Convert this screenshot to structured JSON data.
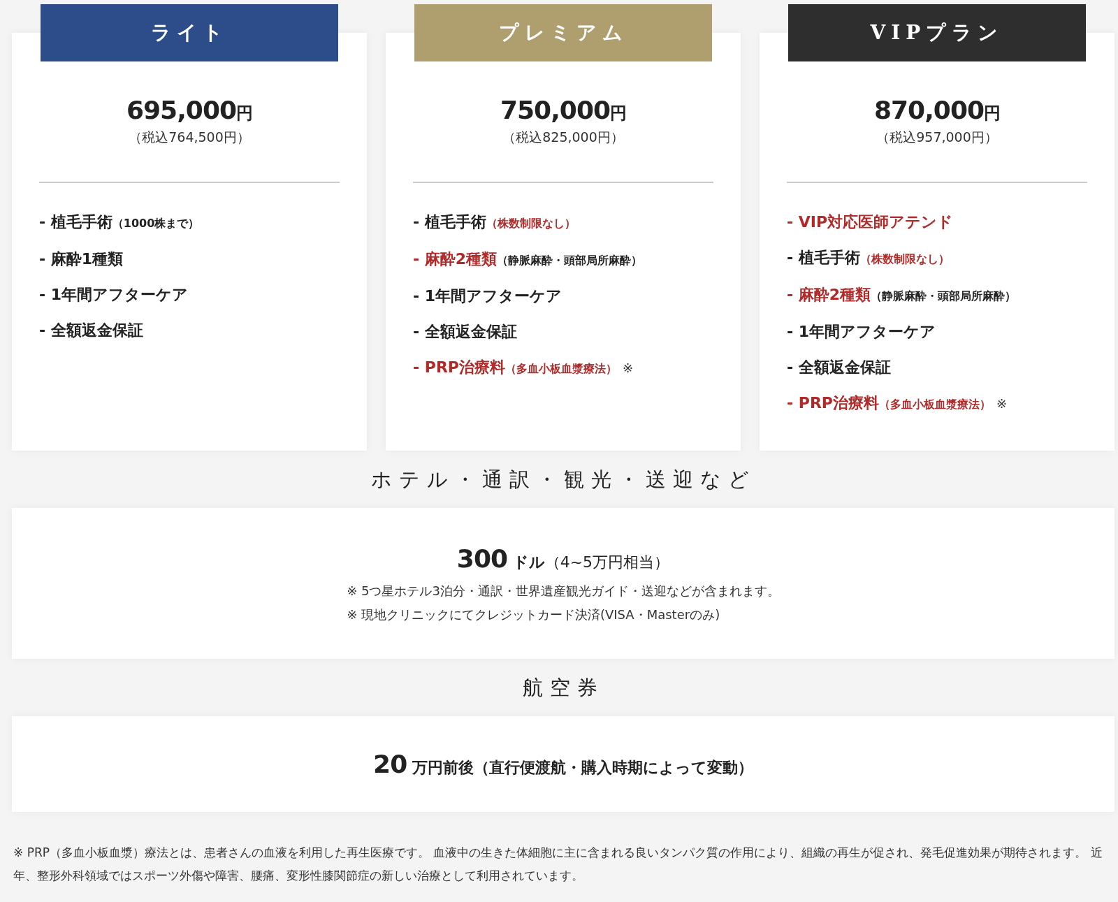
{
  "plans": [
    {
      "name": "ライト",
      "color": "#2c4d8a",
      "price": "695,000",
      "unit": "円",
      "tax": "（税込764,500円）",
      "features": [
        {
          "text": "- 植毛手術",
          "highlight": false,
          "note": "（1000株まで）",
          "note_highlight": false
        },
        {
          "text": "- 麻酔1種類",
          "highlight": false
        },
        {
          "text": "- 1年間アフターケア",
          "highlight": false
        },
        {
          "text": "- 全額返金保証",
          "highlight": false
        }
      ]
    },
    {
      "name": "プレミアム",
      "color": "#b09f6e",
      "price": "750,000",
      "unit": "円",
      "tax": "（税込825,000円）",
      "features": [
        {
          "text": "- 植毛手術",
          "highlight": false,
          "note": "（株数制限なし）",
          "note_highlight": true
        },
        {
          "text": "- 麻酔2種類",
          "highlight": true,
          "note": "（静脈麻酔・頭部局所麻酔）",
          "note_highlight": false
        },
        {
          "text": "- 1年間アフターケア",
          "highlight": false
        },
        {
          "text": "- 全額返金保証",
          "highlight": false
        },
        {
          "text": "- PRP治療料",
          "highlight": true,
          "note": "（多血小板血漿療法）",
          "note_highlight": true,
          "mark": "※"
        }
      ]
    },
    {
      "name": "VIPプラン",
      "color": "#2e2e2e",
      "price": "870,000",
      "unit": "円",
      "tax": "（税込957,000円）",
      "features": [
        {
          "text": "- VIP対応医師アテンド",
          "highlight": true
        },
        {
          "text": "- 植毛手術",
          "highlight": false,
          "note": "（株数制限なし）",
          "note_highlight": true
        },
        {
          "text": "- 麻酔2種類",
          "highlight": true,
          "note": "（静脈麻酔・頭部局所麻酔）",
          "note_highlight": false
        },
        {
          "text": "- 1年間アフターケア",
          "highlight": false
        },
        {
          "text": "- 全額返金保証",
          "highlight": false
        },
        {
          "text": "- PRP治療料",
          "highlight": true,
          "note": "（多血小板血漿療法）",
          "note_highlight": true,
          "mark": "※"
        }
      ]
    }
  ],
  "sections": [
    {
      "heading": "ホテル・通訳・観光・送迎など",
      "amount": "300",
      "unit": "ドル",
      "detail": "（4~5万円相当）",
      "detail_bold": false,
      "notes": [
        "※ 5つ星ホテル3泊分・通訳・世界遺産観光ガイド・送迎などが含まれます。",
        "※ 現地クリニックにてクレジットカード決済(VISA・Masterのみ)"
      ]
    },
    {
      "heading": "航空券",
      "amount": "20",
      "unit": "万円前後",
      "detail": "（直行便渡航・購入時期によって変動）",
      "detail_bold": true
    }
  ],
  "footnote": "※ PRP（多血小板血漿）療法とは、患者さんの血液を利用した再生医療です。 血液中の生きた体細胞に主に含まれる良いタンパク質の作用により、組織の再生が促され、発毛促進効果が期待されます。 近年、整形外科領域ではスポーツ外傷や障害、腰痛、変形性膝関節症の新しい治療として利用されています。"
}
